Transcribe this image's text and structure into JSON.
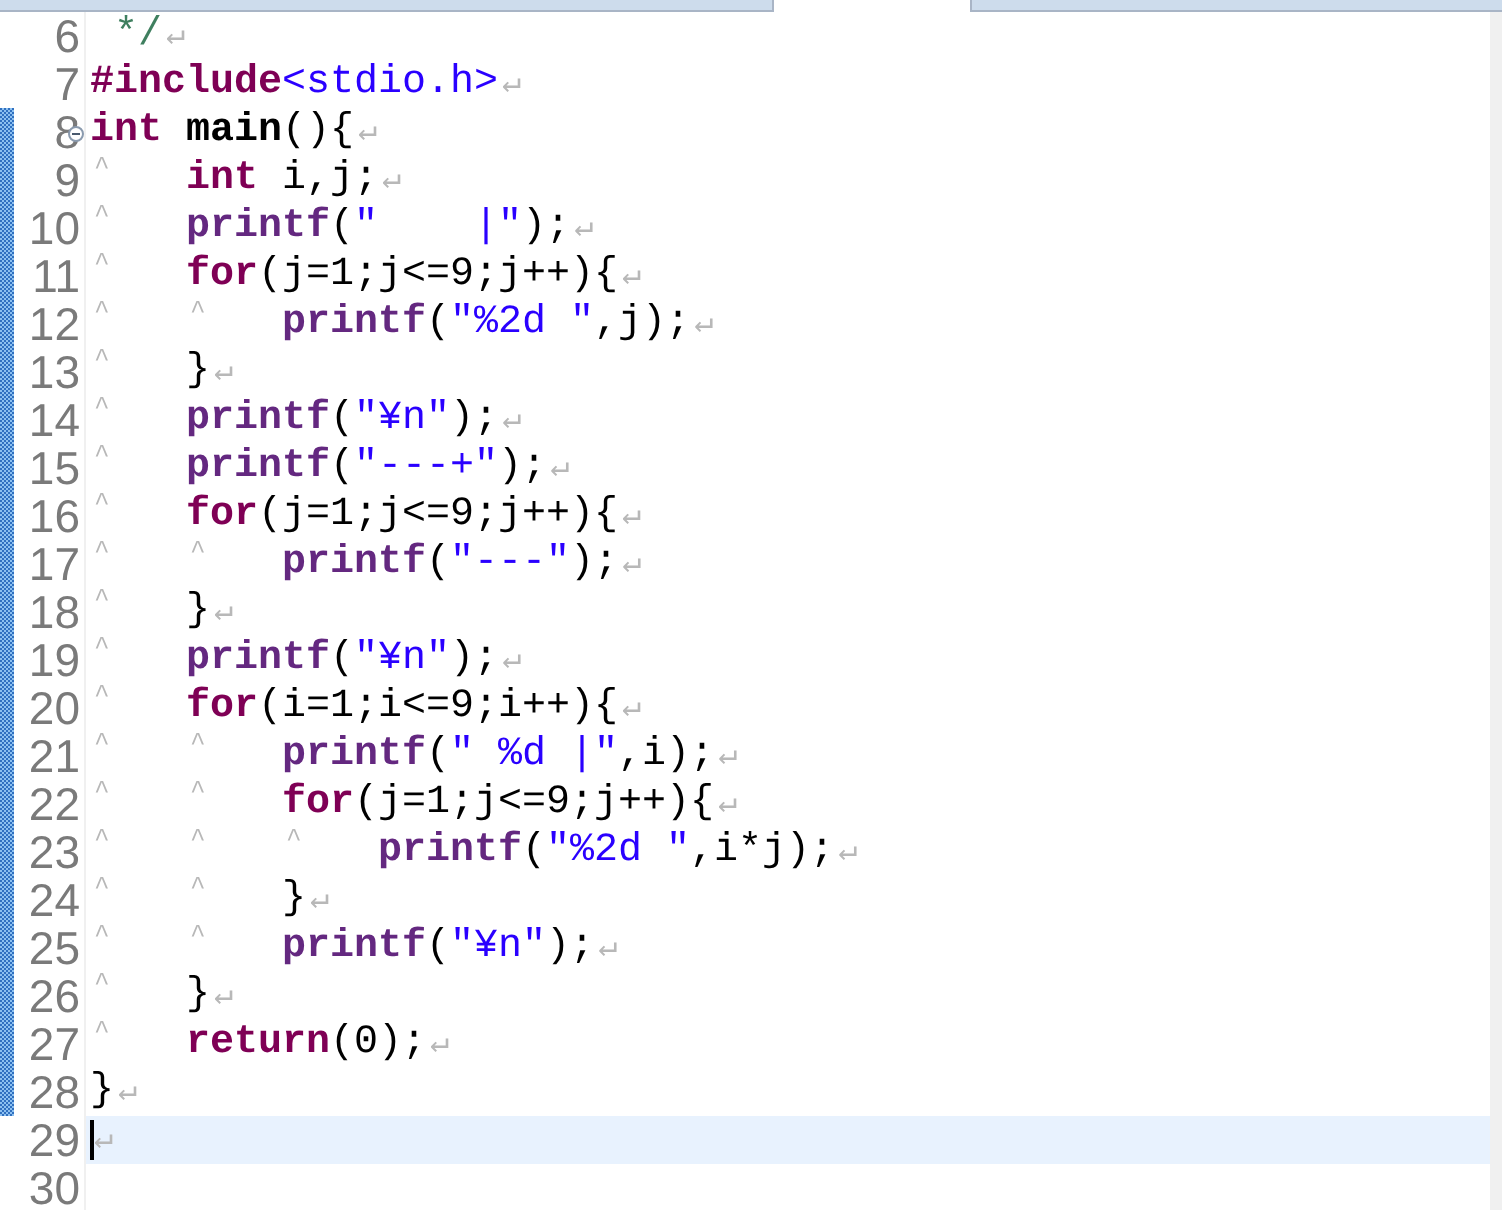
{
  "editor": {
    "lines": [
      {
        "number": "6",
        "changed": false,
        "foldable": false,
        "current": false,
        "tokens": [
          {
            "kind": "comment",
            "text": " */"
          }
        ],
        "eol": "↵"
      },
      {
        "number": "7",
        "changed": false,
        "foldable": false,
        "current": false,
        "tokens": [
          {
            "kind": "preproc",
            "text": "#include"
          },
          {
            "kind": "string",
            "text": "<stdio.h>"
          }
        ],
        "eol": "↵"
      },
      {
        "number": "8",
        "changed": true,
        "foldable": true,
        "current": false,
        "tokens": [
          {
            "kind": "keyword",
            "text": "int"
          },
          {
            "kind": "defname",
            "text": " main"
          },
          {
            "kind": "plain",
            "text": "(){"
          }
        ],
        "eol": "↵"
      },
      {
        "number": "9",
        "changed": true,
        "foldable": false,
        "current": false,
        "tokens": [
          {
            "kind": "tab",
            "text": "^"
          },
          {
            "kind": "keyword",
            "text": "int"
          },
          {
            "kind": "plain",
            "text": " i,j;"
          }
        ],
        "eol": "↵"
      },
      {
        "number": "10",
        "changed": true,
        "foldable": false,
        "current": false,
        "tokens": [
          {
            "kind": "tab",
            "text": "^"
          },
          {
            "kind": "call",
            "text": "printf"
          },
          {
            "kind": "plain",
            "text": "("
          },
          {
            "kind": "string",
            "text": "\"    |\""
          },
          {
            "kind": "plain",
            "text": ");"
          }
        ],
        "eol": "↵"
      },
      {
        "number": "11",
        "changed": true,
        "foldable": false,
        "current": false,
        "tokens": [
          {
            "kind": "tab",
            "text": "^"
          },
          {
            "kind": "keyword",
            "text": "for"
          },
          {
            "kind": "plain",
            "text": "(j=1;j<=9;j++){"
          }
        ],
        "eol": "↵"
      },
      {
        "number": "12",
        "changed": true,
        "foldable": false,
        "current": false,
        "tokens": [
          {
            "kind": "tab",
            "text": "^"
          },
          {
            "kind": "tab",
            "text": "^"
          },
          {
            "kind": "call",
            "text": "printf"
          },
          {
            "kind": "plain",
            "text": "("
          },
          {
            "kind": "string",
            "text": "\"%2d \""
          },
          {
            "kind": "plain",
            "text": ",j);"
          }
        ],
        "eol": "↵"
      },
      {
        "number": "13",
        "changed": true,
        "foldable": false,
        "current": false,
        "tokens": [
          {
            "kind": "tab",
            "text": "^"
          },
          {
            "kind": "plain",
            "text": "}"
          }
        ],
        "eol": "↵"
      },
      {
        "number": "14",
        "changed": true,
        "foldable": false,
        "current": false,
        "tokens": [
          {
            "kind": "tab",
            "text": "^"
          },
          {
            "kind": "call",
            "text": "printf"
          },
          {
            "kind": "plain",
            "text": "("
          },
          {
            "kind": "string",
            "text": "\"¥n\""
          },
          {
            "kind": "plain",
            "text": ");"
          }
        ],
        "eol": "↵"
      },
      {
        "number": "15",
        "changed": true,
        "foldable": false,
        "current": false,
        "tokens": [
          {
            "kind": "tab",
            "text": "^"
          },
          {
            "kind": "call",
            "text": "printf"
          },
          {
            "kind": "plain",
            "text": "("
          },
          {
            "kind": "string",
            "text": "\"---+\""
          },
          {
            "kind": "plain",
            "text": ");"
          }
        ],
        "eol": "↵"
      },
      {
        "number": "16",
        "changed": true,
        "foldable": false,
        "current": false,
        "tokens": [
          {
            "kind": "tab",
            "text": "^"
          },
          {
            "kind": "keyword",
            "text": "for"
          },
          {
            "kind": "plain",
            "text": "(j=1;j<=9;j++){"
          }
        ],
        "eol": "↵"
      },
      {
        "number": "17",
        "changed": true,
        "foldable": false,
        "current": false,
        "tokens": [
          {
            "kind": "tab",
            "text": "^"
          },
          {
            "kind": "tab",
            "text": "^"
          },
          {
            "kind": "call",
            "text": "printf"
          },
          {
            "kind": "plain",
            "text": "("
          },
          {
            "kind": "string",
            "text": "\"---\""
          },
          {
            "kind": "plain",
            "text": ");"
          }
        ],
        "eol": "↵"
      },
      {
        "number": "18",
        "changed": true,
        "foldable": false,
        "current": false,
        "tokens": [
          {
            "kind": "tab",
            "text": "^"
          },
          {
            "kind": "plain",
            "text": "}"
          }
        ],
        "eol": "↵"
      },
      {
        "number": "19",
        "changed": true,
        "foldable": false,
        "current": false,
        "tokens": [
          {
            "kind": "tab",
            "text": "^"
          },
          {
            "kind": "call",
            "text": "printf"
          },
          {
            "kind": "plain",
            "text": "("
          },
          {
            "kind": "string",
            "text": "\"¥n\""
          },
          {
            "kind": "plain",
            "text": ");"
          }
        ],
        "eol": "↵"
      },
      {
        "number": "20",
        "changed": true,
        "foldable": false,
        "current": false,
        "tokens": [
          {
            "kind": "tab",
            "text": "^"
          },
          {
            "kind": "keyword",
            "text": "for"
          },
          {
            "kind": "plain",
            "text": "(i=1;i<=9;i++){"
          }
        ],
        "eol": "↵"
      },
      {
        "number": "21",
        "changed": true,
        "foldable": false,
        "current": false,
        "tokens": [
          {
            "kind": "tab",
            "text": "^"
          },
          {
            "kind": "tab",
            "text": "^"
          },
          {
            "kind": "call",
            "text": "printf"
          },
          {
            "kind": "plain",
            "text": "("
          },
          {
            "kind": "string",
            "text": "\" %d |\""
          },
          {
            "kind": "plain",
            "text": ",i);"
          }
        ],
        "eol": "↵"
      },
      {
        "number": "22",
        "changed": true,
        "foldable": false,
        "current": false,
        "tokens": [
          {
            "kind": "tab",
            "text": "^"
          },
          {
            "kind": "tab",
            "text": "^"
          },
          {
            "kind": "keyword",
            "text": "for"
          },
          {
            "kind": "plain",
            "text": "(j=1;j<=9;j++){"
          }
        ],
        "eol": "↵"
      },
      {
        "number": "23",
        "changed": true,
        "foldable": false,
        "current": false,
        "tokens": [
          {
            "kind": "tab",
            "text": "^"
          },
          {
            "kind": "tab",
            "text": "^"
          },
          {
            "kind": "tab",
            "text": "^"
          },
          {
            "kind": "call",
            "text": "printf"
          },
          {
            "kind": "plain",
            "text": "("
          },
          {
            "kind": "string",
            "text": "\"%2d \""
          },
          {
            "kind": "plain",
            "text": ",i*j);"
          }
        ],
        "eol": "↵"
      },
      {
        "number": "24",
        "changed": true,
        "foldable": false,
        "current": false,
        "tokens": [
          {
            "kind": "tab",
            "text": "^"
          },
          {
            "kind": "tab",
            "text": "^"
          },
          {
            "kind": "plain",
            "text": "}"
          }
        ],
        "eol": "↵"
      },
      {
        "number": "25",
        "changed": true,
        "foldable": false,
        "current": false,
        "tokens": [
          {
            "kind": "tab",
            "text": "^"
          },
          {
            "kind": "tab",
            "text": "^"
          },
          {
            "kind": "call",
            "text": "printf"
          },
          {
            "kind": "plain",
            "text": "("
          },
          {
            "kind": "string",
            "text": "\"¥n\""
          },
          {
            "kind": "plain",
            "text": ");"
          }
        ],
        "eol": "↵"
      },
      {
        "number": "26",
        "changed": true,
        "foldable": false,
        "current": false,
        "tokens": [
          {
            "kind": "tab",
            "text": "^"
          },
          {
            "kind": "plain",
            "text": "}"
          }
        ],
        "eol": "↵"
      },
      {
        "number": "27",
        "changed": true,
        "foldable": false,
        "current": false,
        "tokens": [
          {
            "kind": "tab",
            "text": "^"
          },
          {
            "kind": "keyword",
            "text": "return"
          },
          {
            "kind": "plain",
            "text": "(0);"
          }
        ],
        "eol": "↵"
      },
      {
        "number": "28",
        "changed": true,
        "foldable": false,
        "current": false,
        "tokens": [
          {
            "kind": "plain",
            "text": "}"
          }
        ],
        "eol": "↵"
      },
      {
        "number": "29",
        "changed": false,
        "foldable": false,
        "current": true,
        "eol": "↵"
      },
      {
        "number": "30",
        "changed": false,
        "foldable": false,
        "current": false
      }
    ]
  }
}
